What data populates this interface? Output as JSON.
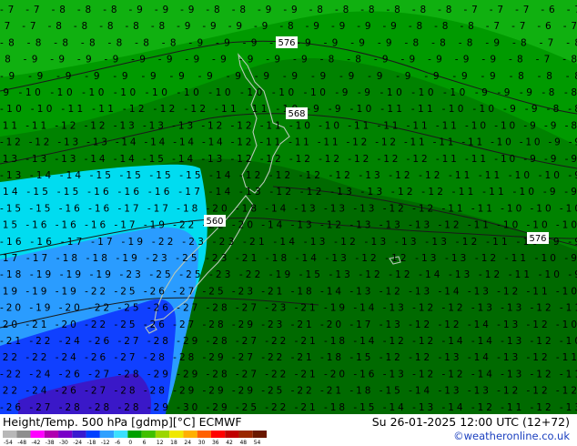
{
  "footer": {
    "title": "Height/Temp. 500 hPa [gdmp][°C] ECMWF",
    "datetime": "Su 26-01-2025 12:00 UTC (12+72)",
    "credit": "©weatheronline.co.uk"
  },
  "colorbar": {
    "labels": [
      "-54",
      "-48",
      "-42",
      "-38",
      "-30",
      "-24",
      "-18",
      "-12",
      "-6",
      "0",
      "6",
      "12",
      "18",
      "24",
      "30",
      "36",
      "42",
      "48",
      "54"
    ],
    "colors": [
      "#b8b8b8",
      "#8e8e8e",
      "#ff00ff",
      "#b000b0",
      "#7a00c8",
      "#3a1ad0",
      "#0040ff",
      "#2fa0ff",
      "#3ce0ff",
      "#00a000",
      "#40c000",
      "#9cd600",
      "#f0e800",
      "#ffb000",
      "#ff6000",
      "#ff0000",
      "#c00000",
      "#9a2800",
      "#6a1800"
    ]
  },
  "contour_labels": [
    "576",
    "568",
    "560",
    "576"
  ],
  "temp_rows": [
    "-7 -7 -8 -8 -8 -9 -9 -9 -8 -8 -9 -9 -8 -8 -8 -8 -8 -8 -7 -7 -7 -6 -7",
    "-7 -7 -8 -8 -8 -8 -8 -9 -9 -9 -9 -8 -9 -9 -9 -9 -8 -8 -8 -7 -7 -6 -7",
    "-8 -8 -8 -8 -8 -8 -8 -9 -9 -9 -9 -9 -9 -9 -9 -8 -8 -8 -9 -8 -7 -8",
    "-8 -9 -9 -9 -9 -9 -9 -9 -9 -9 -9 -9 -8 -8 -9 -9 -9 -9 -9 -8 -7 -8",
    "-9 -9 -9 -9 -9 -9 -9 -9 -9 -9 -9 -9 -9 -9 -9 -9 -9 -9 -8 -8 -8",
    "-9 -10 -10 -10 -10 -10 -10 -10 -10 -10 -10 -9 -9 -10 -10 -10 -9 -9 -9 -8 -8",
    "-10 -10 -11 -11 -12 -12 -12 -11 -11 -10 -9 -9 -10 -11 -11 -10 -10 -9 -9 -8 -8",
    "-11 -11 -12 -12 -13 -13 -13 -12 -12 -11 -10 -10 -11 -11 -11 -11 -10 -10 -9 -9 -8",
    "-12 -12 -13 -13 -14 -14 -14 -14 -12 -11 -11 -11 -12 -12 -11 -11 -11 -10 -10 -9 -9",
    "-13 -13 -13 -14 -14 -15 -14 -13 -12 -12 -12 -12 -12 -12 -12 -11 -11 -10 -9 -9 -9",
    "-13 -14 -14 -15 -15 -15 -15 -14 -12 -12 -12 -12 -13 -12 -12 -11 -11 -10 -10 -9",
    "-14 -15 -15 -16 -16 -16 -17 -14 -13 -12 -12 -13 -13 -12 -12 -11 -11 -10 -9 -9",
    "-15 -15 -16 -16 -17 -17 -18 -20 -18 -14 -13 -13 -13 -12 -12 -11 -11 -10 -10 -10",
    "-15 -16 -16 -16 -17 -19 -22 -22 -20 -14 -13 -12 -13 -13 -13 -12 -11 -10 -10 -10",
    "-16 -16 -17 -17 -19 -22 -23 -23 -21 -14 -13 -12 -13 -13 -13 -12 -11 -10 -9 -9",
    "-17 -17 -18 -18 -19 -23 -25 -23 -21 -18 -14 -13 -12 -12 -13 -13 -12 -11 -10 -9",
    "-18 -19 -19 -19 -23 -25 -25 -23 -22 -19 -15 -13 -12 -12 -14 -13 -12 -11 -10 -9",
    "-19 -19 -19 -22 -25 -26 -27 -25 -23 -21 -18 -14 -13 -12 -13 -14 -13 -12 -11 -10",
    "-20 -19 -20 -22 -25 -26 -27 -28 -27 -23 -21 -19 -14 -13 -12 -12 -13 -13 -12 -11",
    "-20 -21 -20 -22 -25 -26 -27 -28 -29 -23 -21 -20 -17 -13 -12 -12 -14 -13 -12 -10",
    "-21 -22 -24 -26 -27 -28 -29 -28 -27 -22 -21 -18 -14 -12 -12 -14 -14 -13 -12 -10",
    "-22 -22 -24 -26 -27 -28 -28 -29 -27 -22 -21 -18 -15 -12 -12 -13 -14 -13 -12 -11",
    "-22 -24 -26 -27 -28 -29 -29 -28 -27 -22 -21 -20 -16 -13 -12 -12 -14 -13 -12 -11",
    "-22 -24 -26 -27 -28 -28 -29 -29 -29 -25 -22 -21 -18 -15 -14 -13 -13 -12 -12 -12",
    "-26 -27 -28 -28 -28 -29 -30 -29 -25 -22 -21 -18 -15 -14 -13 -14 -12 -11 -12 -13"
  ]
}
